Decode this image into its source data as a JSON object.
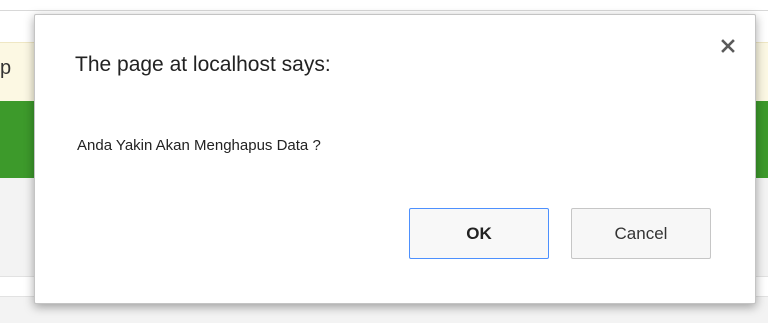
{
  "background_page": {
    "partial_text": "p"
  },
  "dialog": {
    "title": "The page at localhost says:",
    "message": "Anda Yakin Akan Menghapus Data ?",
    "close_icon": "close-icon",
    "ok_label": "OK",
    "cancel_label": "Cancel"
  },
  "colors": {
    "green_bar": "#3d9a2b",
    "yellow_bar": "#fcf8e3",
    "ok_focus_border": "#4d90fe"
  }
}
